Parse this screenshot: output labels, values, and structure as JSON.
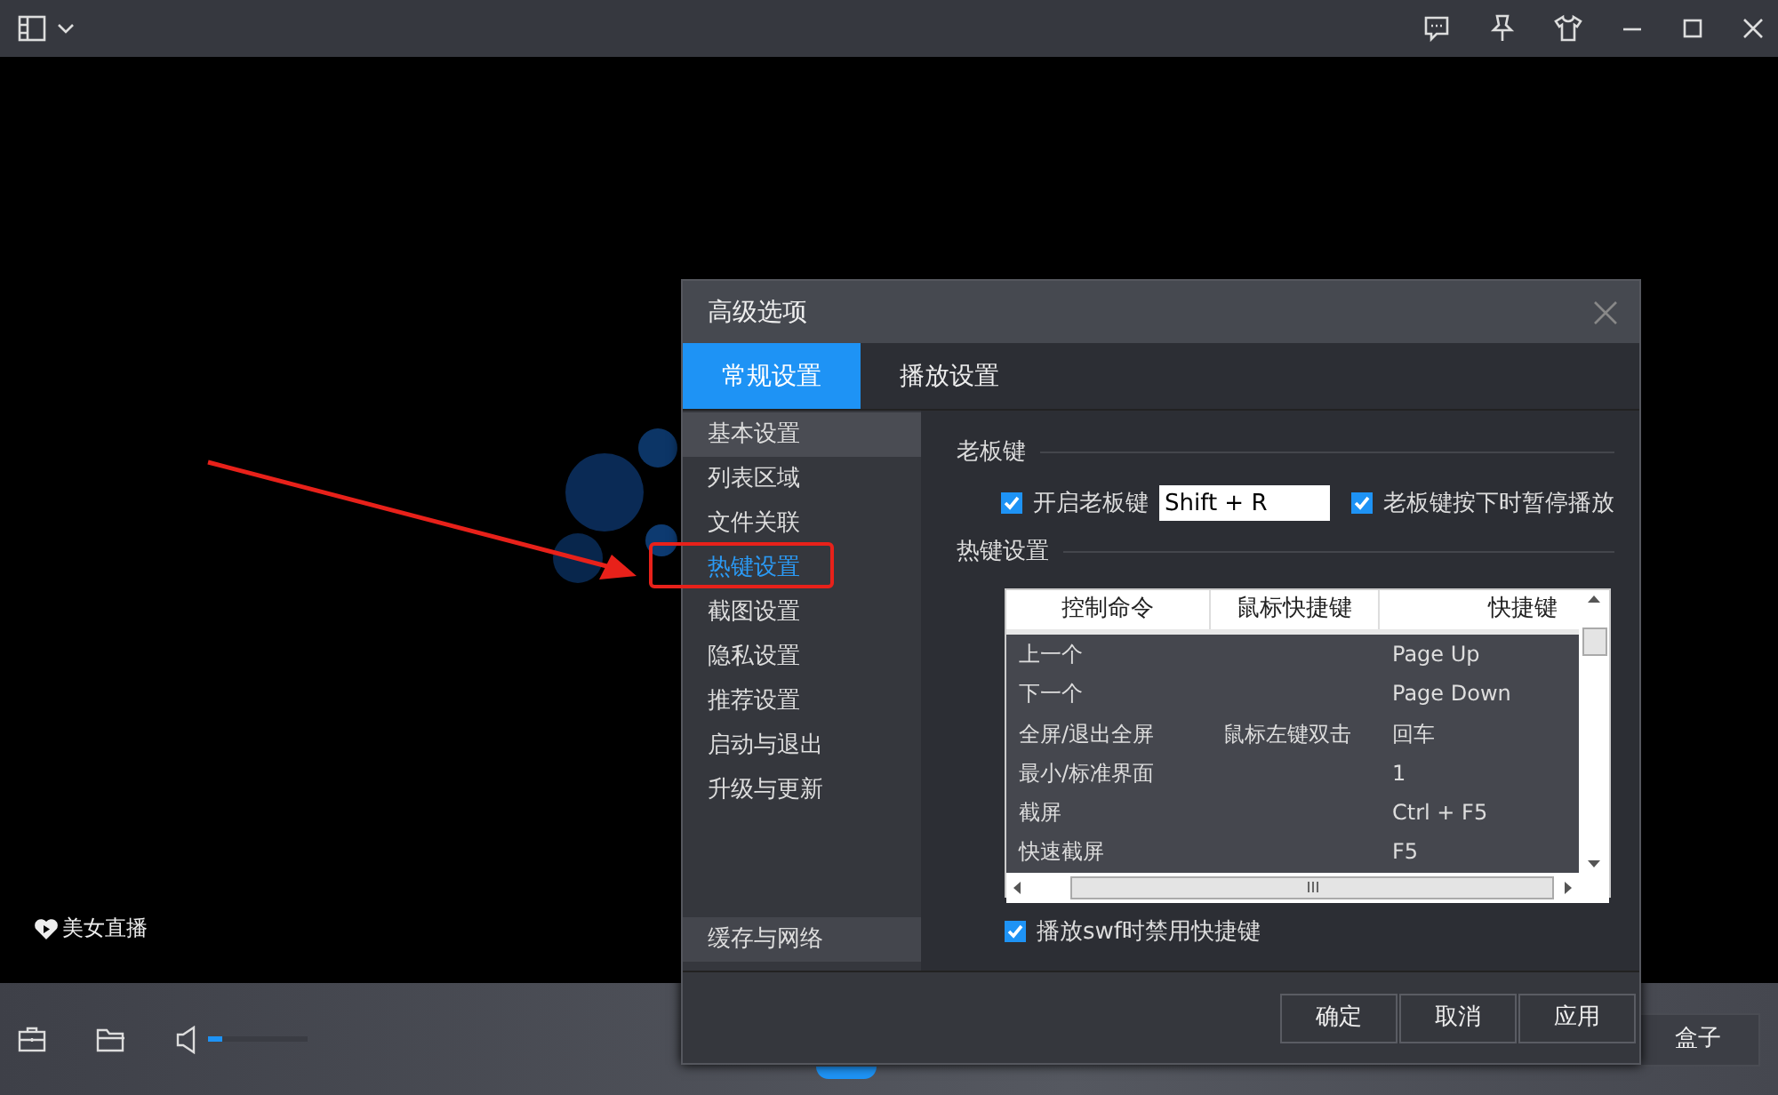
{
  "promo": {
    "label": "美女直播"
  },
  "dialog": {
    "title": "高级选项",
    "tabs": [
      {
        "label": "常规设置",
        "selected": true
      },
      {
        "label": "播放设置",
        "selected": false
      }
    ],
    "sidebar": {
      "items": [
        {
          "label": "基本设置",
          "selected": true,
          "highlighted": false
        },
        {
          "label": "列表区域",
          "selected": false,
          "highlighted": false
        },
        {
          "label": "文件关联",
          "selected": false,
          "highlighted": false
        },
        {
          "label": "热键设置",
          "selected": false,
          "highlighted": true
        },
        {
          "label": "截图设置",
          "selected": false,
          "highlighted": false
        },
        {
          "label": "隐私设置",
          "selected": false,
          "highlighted": false
        },
        {
          "label": "推荐设置",
          "selected": false,
          "highlighted": false
        },
        {
          "label": "启动与退出",
          "selected": false,
          "highlighted": false
        },
        {
          "label": "升级与更新",
          "selected": false,
          "highlighted": false
        }
      ],
      "footer_item": "缓存与网络"
    },
    "boss_key": {
      "heading": "老板键",
      "enable": {
        "label": "开启老板键",
        "checked": true
      },
      "key_value": "Shift + R",
      "pause": {
        "label": "老板键按下时暂停播放",
        "checked": true
      }
    },
    "hotkeys": {
      "heading": "热键设置",
      "columns": [
        "控制命令",
        "鼠标快捷键",
        "快捷键"
      ],
      "rows": [
        [
          "上一个",
          "",
          "Page Up"
        ],
        [
          "下一个",
          "",
          "Page Down"
        ],
        [
          "全屏/退出全屏",
          "鼠标左键双击",
          "回车"
        ],
        [
          "最小/标准界面",
          "",
          "1"
        ],
        [
          "截屏",
          "",
          "Ctrl + F5"
        ],
        [
          "快速截屏",
          "",
          "F5"
        ]
      ],
      "disable_swf": {
        "label": "播放swf时禁用快捷键",
        "checked": true
      }
    },
    "buttons": [
      "确定",
      "取消",
      "应用"
    ]
  },
  "bottom_bar": {
    "volume": {
      "level": 0.15
    },
    "box_button": "盒子"
  }
}
